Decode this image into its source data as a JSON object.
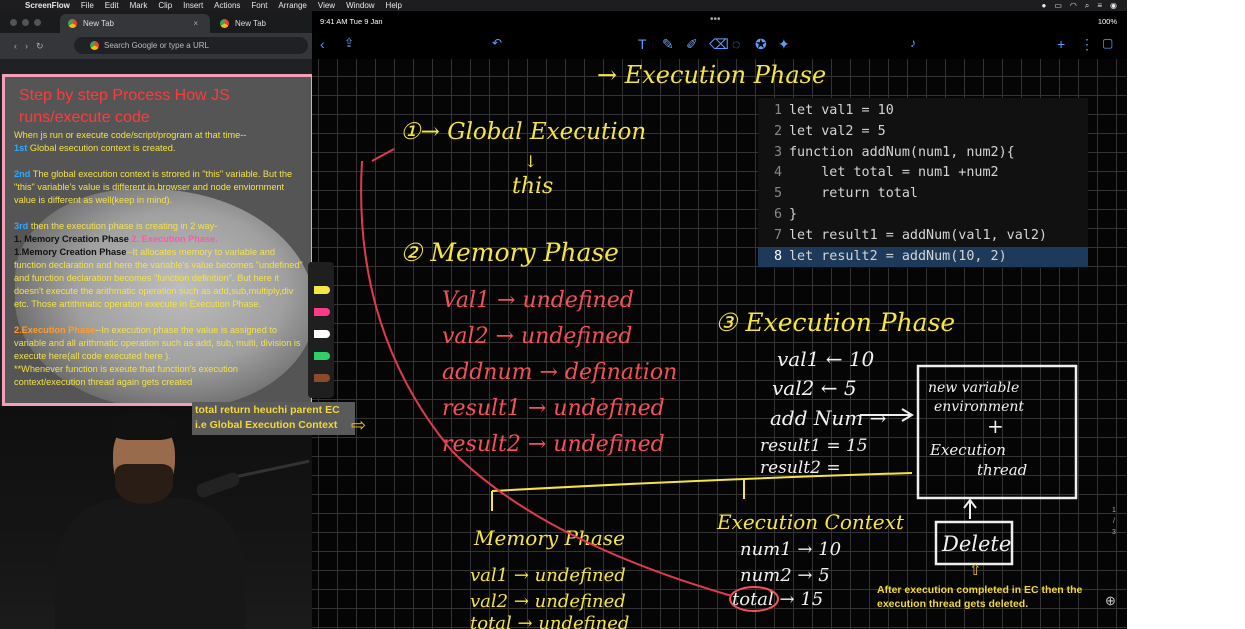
{
  "menubar": {
    "items": [
      "ScreenFlow",
      "File",
      "Edit",
      "Mark",
      "Clip",
      "Insert",
      "Actions",
      "Font",
      "Arrange",
      "View",
      "Window",
      "Help"
    ]
  },
  "browser": {
    "tabs": [
      {
        "label": "New Tab"
      },
      {
        "label": "New Tab"
      }
    ],
    "address_placeholder": "Search Google or type a URL"
  },
  "notes": {
    "title": "Step by step Process How JS runs/execute code",
    "intro": "When js run or execute code/script/program at that time--",
    "step1_num": "1st",
    "step1_text": " Global esecution context is created.",
    "step2_num": "2nd",
    "step2_text": " The global execution context is strored in \"this\" variable. But the \"this\" variable's value is different in browser and node enviornment value is different  as well(keep in mind).",
    "step3_num": "3rd",
    "step3_text": " then the execution phase is creating in 2 way-",
    "phase_line_a": "1. Memory Creation Phase",
    "phase_line_b": " 2. Execution Phase.",
    "mem_label": "1.Memory Creation Phase",
    "mem_text": "--It allocates memory to variable and function declaration and here the variable's value becomes \"undefined\" and function declaration becomes \"function definition\". But here it doesn't execute the arithmatic operation such as add,sub,multiply,div etc. Those artithmatic operation execute in Execution Phase.",
    "exec_label": "2.Execution Phase",
    "exec_text": "--In execution phase the value is assigned to variable and all arithmatic operation such as add, sub, multi, division is execute here(all code executed here ).",
    "exec_note": "**Whenever function is exeute that function's execution context/execution thread again gets created"
  },
  "ipad": {
    "time": "9:41 AM  Tue 9 Jan",
    "battery": "100%"
  },
  "code": {
    "lines": [
      {
        "n": "1",
        "text": "let val1 = 10"
      },
      {
        "n": "2",
        "text": "let val2 = 5"
      },
      {
        "n": "3",
        "text": "function addNum(num1, num2){"
      },
      {
        "n": "4",
        "text": "    let total = num1 +num2"
      },
      {
        "n": "5",
        "text": "    return total"
      },
      {
        "n": "6",
        "text": "}"
      },
      {
        "n": "7",
        "text": "let result1 = addNum(val1, val2)"
      },
      {
        "n": "8",
        "text": "let result2 = addNum(10, 2)"
      }
    ]
  },
  "board": {
    "top_title": "→ Execution Phase",
    "step1": "①→ Global Execution",
    "this": "this",
    "step2": "② Memory Phase",
    "mem_rows": [
      "Val1 → undefined",
      "val2 → undefined",
      "addnum → defination",
      "result1 → undefined",
      "result2 → undefined"
    ],
    "step3": "③ Execution Phase",
    "exec_rows": [
      "val1 ← 10",
      "val2 ← 5",
      "add Num →",
      "result1 = 15",
      "result2 ="
    ],
    "new_env": [
      "new variable",
      "environment",
      "+",
      "Execution",
      "thread"
    ],
    "delete": "Delete",
    "ec_title": "Execution Context",
    "ec_rows": [
      "num1 → 10",
      "num2 → 5",
      "total → 15"
    ],
    "mem2_title": "Memory Phase",
    "mem2_rows": [
      "val1 → undefined",
      "val2 → undefined",
      "total → undefined"
    ]
  },
  "overlays": {
    "return_note": "total return heuchi parent EC i.e Global Execution Context",
    "after_note": "After execution completed in EC then the execution thread gets deleted.",
    "page_indicator": [
      "1",
      "/",
      "3"
    ]
  }
}
